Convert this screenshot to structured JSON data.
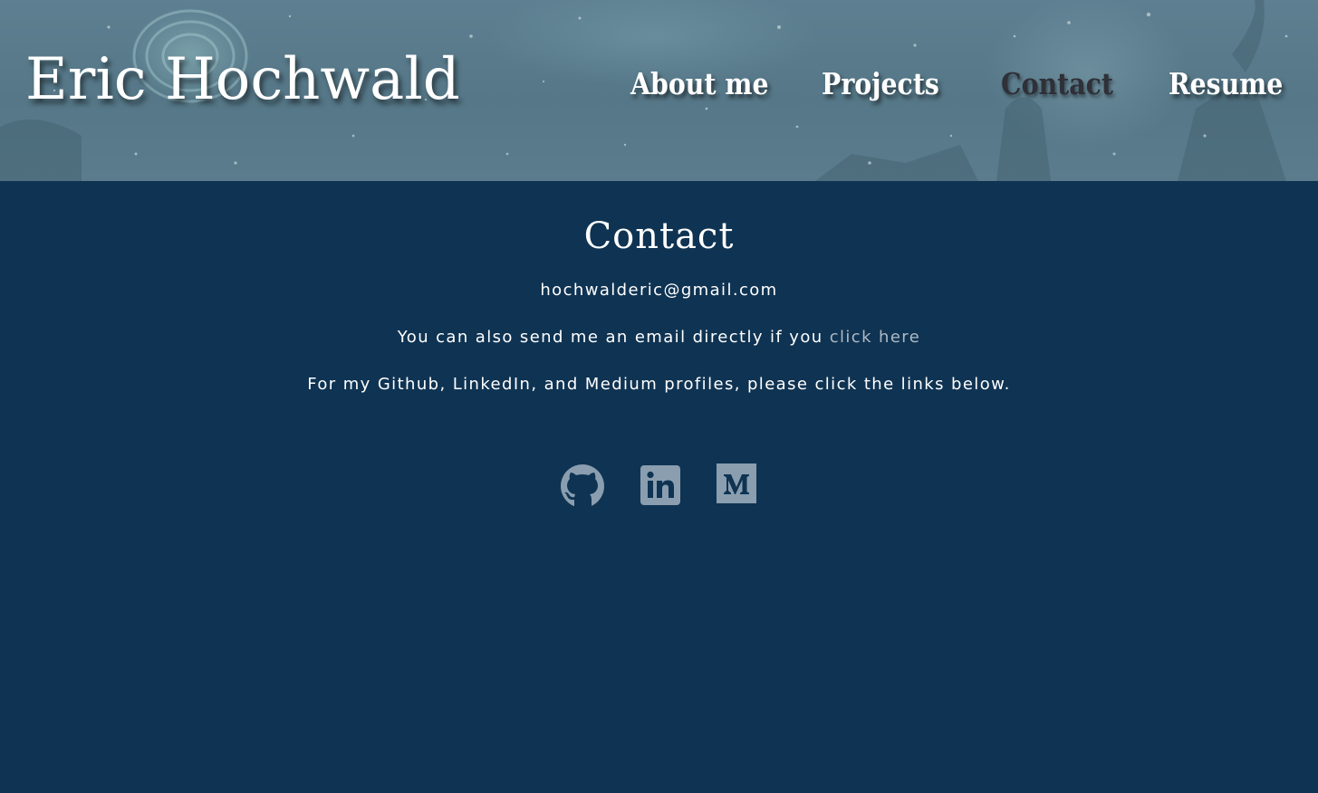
{
  "header": {
    "site_title": "Eric Hochwald",
    "nav": [
      {
        "label": "About me",
        "active": false
      },
      {
        "label": "Projects",
        "active": false
      },
      {
        "label": "Contact",
        "active": true
      },
      {
        "label": "Resume",
        "active": false
      }
    ]
  },
  "main": {
    "heading": "Contact",
    "email": "hochwalderic@gmail.com",
    "send_text": "You can also send me an email directly if you",
    "send_link": "click here",
    "profiles_text": "For my Github, LinkedIn, and Medium profiles, please click the links below.",
    "social_links": [
      {
        "name": "Github",
        "icon": "github-icon"
      },
      {
        "name": "LinkedIn",
        "icon": "linkedin-icon"
      },
      {
        "name": "Medium",
        "icon": "medium-icon"
      }
    ]
  },
  "colors": {
    "page_background": "#0f3352",
    "header_background": "#5a7c8c",
    "text": "#ffffff",
    "active_nav": "#2f3038",
    "link": "#aeb9c4",
    "icons": "#8a9eb0"
  }
}
